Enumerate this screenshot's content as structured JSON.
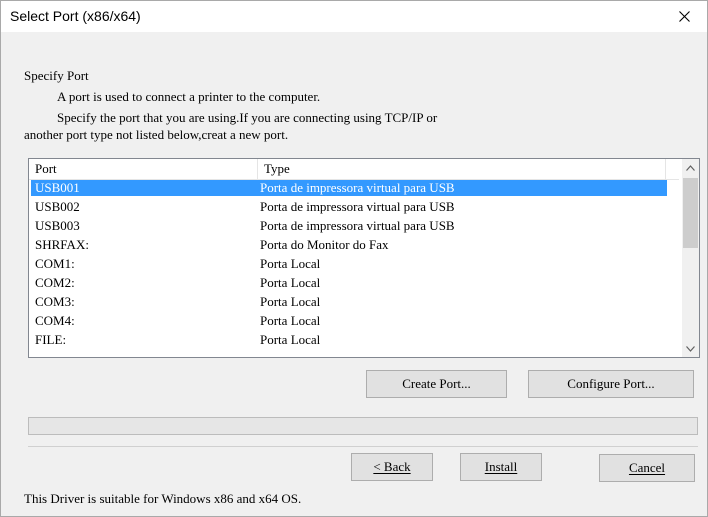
{
  "window": {
    "title": "Select Port (x86/x64)"
  },
  "intro": {
    "heading": "Specify Port",
    "line1": "A port is used to connect a printer to the computer.",
    "line2": "Specify the port that you are using.If you are connecting using TCP/IP or",
    "line3": "another port type not listed below,creat a new port."
  },
  "port_list": {
    "columns": [
      "Port",
      "Type"
    ],
    "rows": [
      {
        "port": "USB001",
        "type": "Porta de impressora virtual para USB",
        "selected": true
      },
      {
        "port": "USB002",
        "type": "Porta de impressora virtual para USB",
        "selected": false
      },
      {
        "port": "USB003",
        "type": "Porta de impressora virtual para USB",
        "selected": false
      },
      {
        "port": "SHRFAX:",
        "type": "Porta do Monitor do Fax",
        "selected": false
      },
      {
        "port": "COM1:",
        "type": "Porta Local",
        "selected": false
      },
      {
        "port": "COM2:",
        "type": "Porta Local",
        "selected": false
      },
      {
        "port": "COM3:",
        "type": "Porta Local",
        "selected": false
      },
      {
        "port": "COM4:",
        "type": "Porta Local",
        "selected": false
      },
      {
        "port": "FILE:",
        "type": "Porta Local",
        "selected": false
      }
    ]
  },
  "buttons": {
    "create_port": "Create Port...",
    "configure_port": "Configure Port...",
    "back": "< Back",
    "install": "Install",
    "cancel": "Cancel"
  },
  "footer": {
    "note": "This Driver is suitable for Windows x86 and x64 OS."
  },
  "colors": {
    "selection": "#3399ff",
    "default_button_border": "#0078d7"
  },
  "icons": [
    "close-icon",
    "scroll-up-icon",
    "scroll-down-icon"
  ]
}
